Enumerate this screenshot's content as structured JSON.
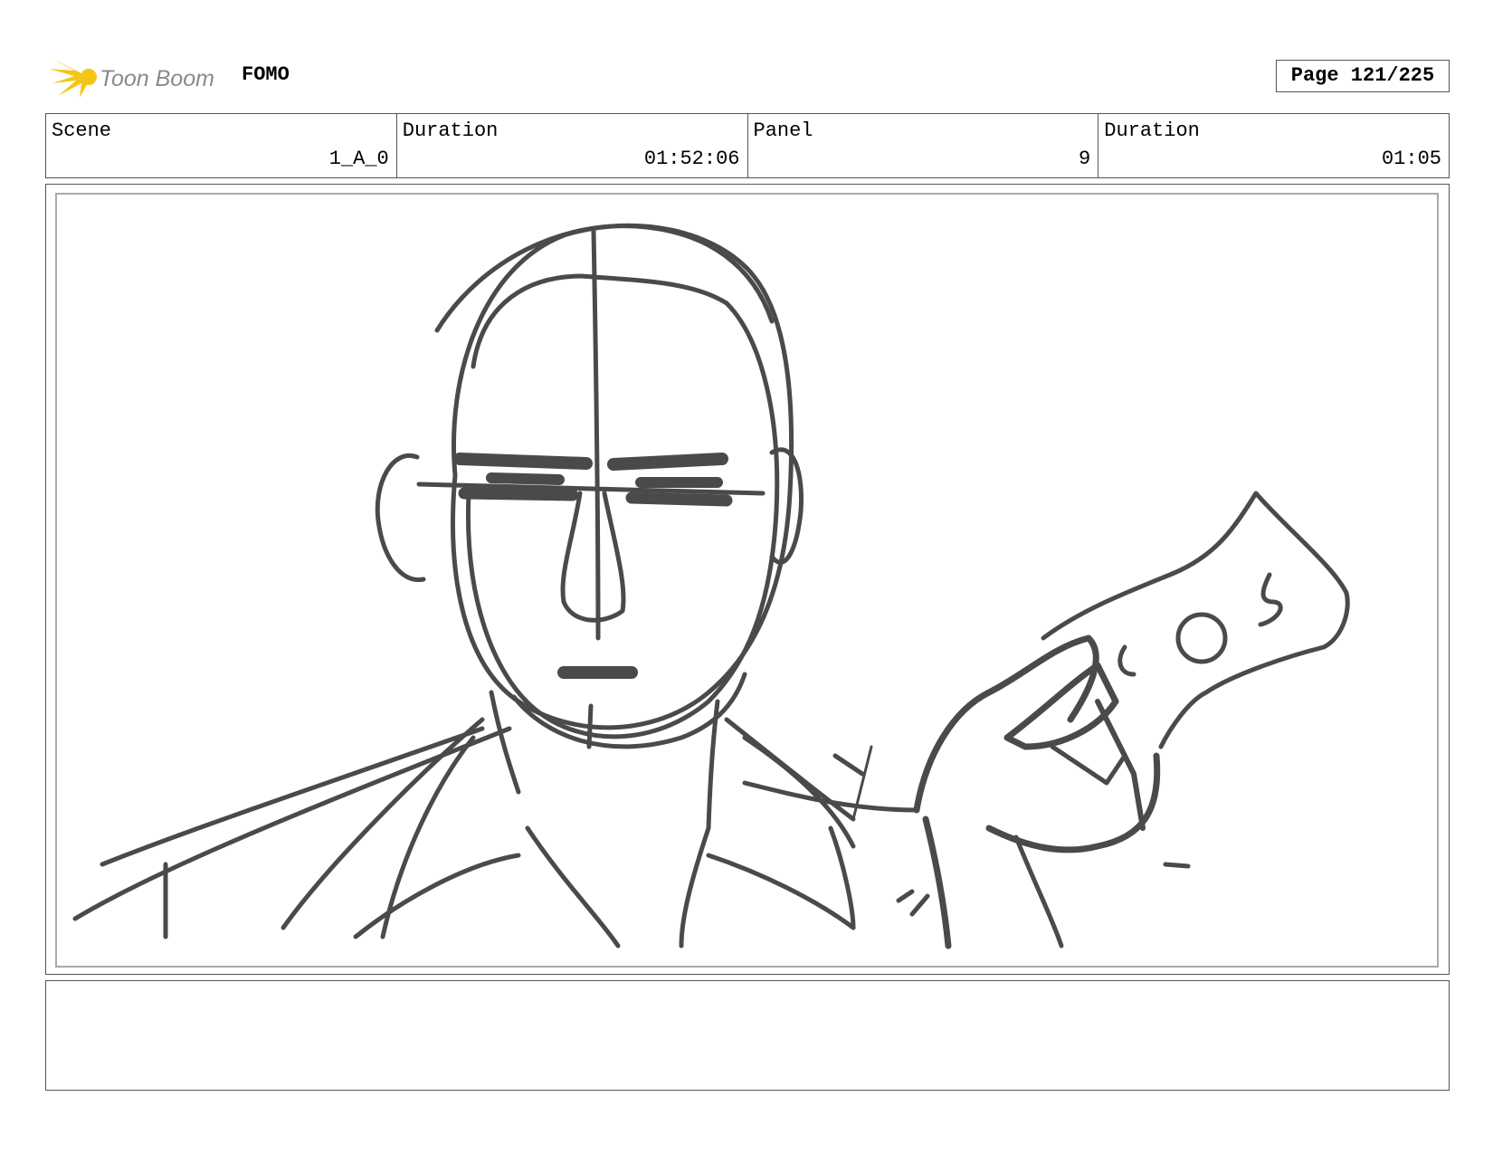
{
  "header": {
    "logo_text": "Toon Boom",
    "project_title": "FOMO",
    "page_label": "Page 121/225"
  },
  "info": {
    "scene_label": "Scene",
    "scene_value": "1_A_0",
    "scene_duration_label": "Duration",
    "scene_duration_value": "01:52:06",
    "panel_label": "Panel",
    "panel_value": "9",
    "panel_duration_label": "Duration",
    "panel_duration_value": "01:05"
  },
  "colors": {
    "logo_yellow": "#f5c518",
    "logo_text": "#8a8a8a",
    "sketch": "#4a4a4a"
  },
  "notes": {
    "text": ""
  }
}
